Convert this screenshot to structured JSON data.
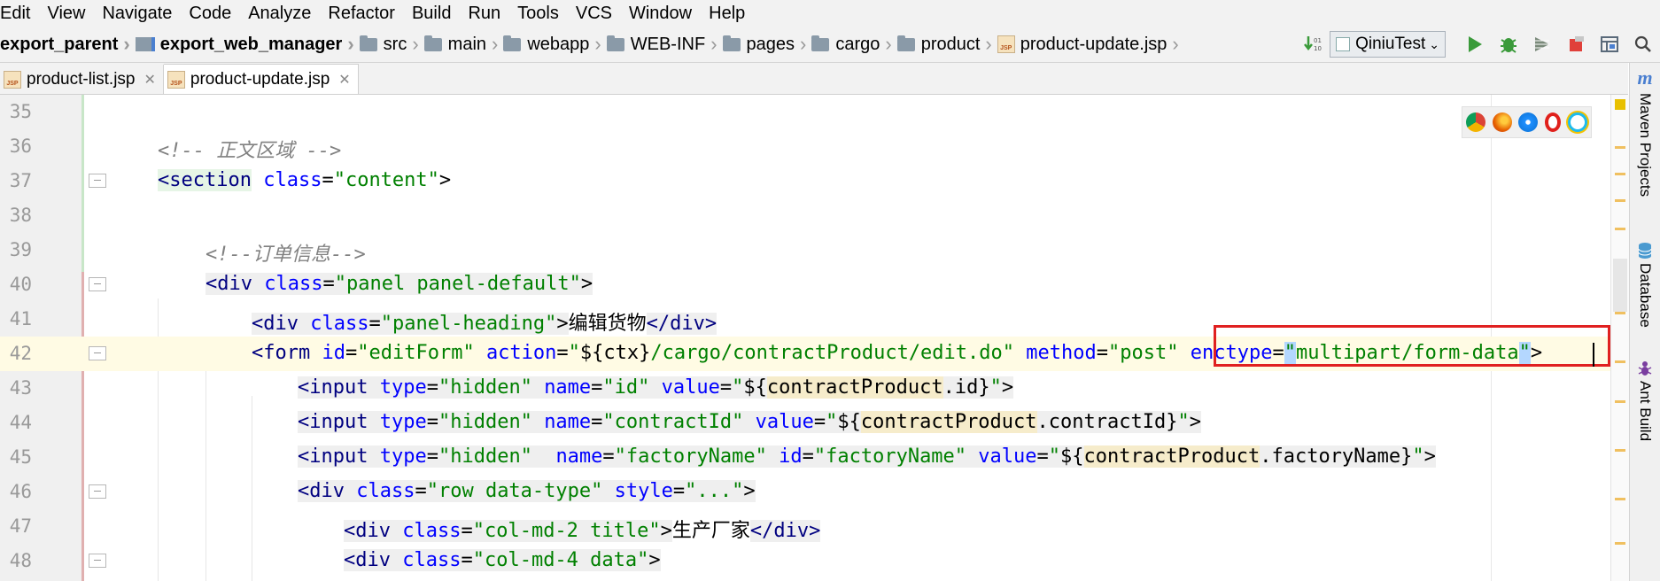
{
  "menu": [
    "Edit",
    "View",
    "Navigate",
    "Code",
    "Analyze",
    "Refactor",
    "Build",
    "Run",
    "Tools",
    "VCS",
    "Window",
    "Help"
  ],
  "breadcrumbs": [
    {
      "label": "export_parent",
      "icon": "module-icon",
      "bold": true
    },
    {
      "label": "export_web_manager",
      "icon": "module-icon",
      "bold": true
    },
    {
      "label": "src",
      "icon": "folder-icon"
    },
    {
      "label": "main",
      "icon": "folder-icon"
    },
    {
      "label": "webapp",
      "icon": "folder-icon"
    },
    {
      "label": "WEB-INF",
      "icon": "folder-icon"
    },
    {
      "label": "pages",
      "icon": "folder-icon"
    },
    {
      "label": "cargo",
      "icon": "folder-icon"
    },
    {
      "label": "product",
      "icon": "folder-icon"
    },
    {
      "label": "product-update.jsp",
      "icon": "jsp-file-icon"
    }
  ],
  "run_config": "QiniuTest",
  "tabs": [
    {
      "label": "product-list.jsp",
      "active": false
    },
    {
      "label": "product-update.jsp",
      "active": true
    }
  ],
  "file_icon_text": "JSP",
  "colors": {
    "tag": "#000080",
    "attribute": "#0000ff",
    "value": "#008000",
    "comment": "#808080",
    "highlight_box": "#e02020",
    "current_line": "#fffbe4"
  },
  "right_tools": [
    "Maven Projects",
    "Database",
    "Ant Build"
  ],
  "lines": [
    {
      "n": "35",
      "t": ""
    },
    {
      "n": "36",
      "t": "<!-- 正文区域 -->"
    },
    {
      "n": "37",
      "t": "<section class=\"content\">"
    },
    {
      "n": "38",
      "t": ""
    },
    {
      "n": "39",
      "t": "<!--订单信息-->"
    },
    {
      "n": "40",
      "t": "<div class=\"panel panel-default\">"
    },
    {
      "n": "41",
      "t": "<div class=\"panel-heading\">编辑货物</div>"
    },
    {
      "n": "42",
      "t": "<form id=\"editForm\" action=\"${ctx}/cargo/contractProduct/edit.do\" method=\"post\" enctype=\"multipart/form-data\">"
    },
    {
      "n": "43",
      "t": "<input type=\"hidden\" name=\"id\" value=\"${contractProduct.id}\">"
    },
    {
      "n": "44",
      "t": "<input type=\"hidden\" name=\"contractId\" value=\"${contractProduct.contractId}\">"
    },
    {
      "n": "45",
      "t": "<input type=\"hidden\"  name=\"factoryName\" id=\"factoryName\" value=\"${contractProduct.factoryName}\">"
    },
    {
      "n": "46",
      "t": "<div class=\"row data-type\" style=\"...\">"
    },
    {
      "n": "47",
      "t": "<div class=\"col-md-2 title\">生产厂家</div>"
    },
    {
      "n": "48",
      "t": "<div class=\"col-md-4 data\">"
    }
  ]
}
